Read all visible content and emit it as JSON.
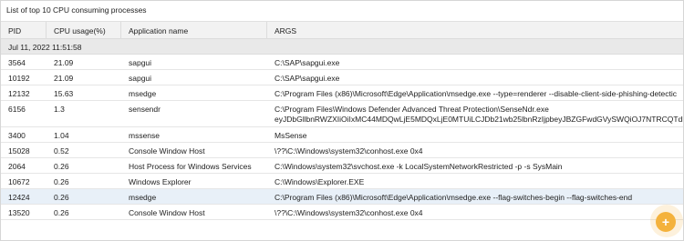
{
  "panel": {
    "title": "List of top 10 CPU consuming processes"
  },
  "table": {
    "columns": [
      "PID",
      "CPU usage(%)",
      "Application name",
      "ARGS"
    ],
    "group_label": "Jul 11, 2022 11:51:58",
    "rows": [
      {
        "pid": "3564",
        "cpu": "21.09",
        "app": "sapgui",
        "args": [
          "C:\\SAP\\sapgui.exe"
        ]
      },
      {
        "pid": "10192",
        "cpu": "21.09",
        "app": "sapgui",
        "args": [
          "C:\\SAP\\sapgui.exe"
        ]
      },
      {
        "pid": "12132",
        "cpu": "15.63",
        "app": "msedge",
        "args": [
          "C:\\Program Files (x86)\\Microsoft\\Edge\\Application\\msedge.exe --type=renderer --disable-client-side-phishing-detectic"
        ]
      },
      {
        "pid": "6156",
        "cpu": "1.3",
        "app": "sensendr",
        "args": [
          "C:\\Program Files\\Windows Defender Advanced Threat Protection\\SenseNdr.exe",
          "eyJDbGllbnRWZXIiOiIxMC44MDQwLjE5MDQxLjE0MTUiLCJDb21wb25lbnRzIjpbeyJBZGFwdGVySWQiOJ7NTRCQTdEC"
        ]
      },
      {
        "pid": "3400",
        "cpu": "1.04",
        "app": "mssense",
        "args": [
          "MsSense"
        ]
      },
      {
        "pid": "15028",
        "cpu": "0.52",
        "app": "Console Window Host",
        "args": [
          "\\??\\C:\\Windows\\system32\\conhost.exe 0x4"
        ]
      },
      {
        "pid": "2064",
        "cpu": "0.26",
        "app": "Host Process for Windows Services",
        "args": [
          "C:\\Windows\\system32\\svchost.exe -k LocalSystemNetworkRestricted -p -s SysMain"
        ]
      },
      {
        "pid": "10672",
        "cpu": "0.26",
        "app": "Windows Explorer",
        "args": [
          "C:\\Windows\\Explorer.EXE"
        ]
      },
      {
        "pid": "12424",
        "cpu": "0.26",
        "app": "msedge",
        "args": [
          "C:\\Program Files (x86)\\Microsoft\\Edge\\Application\\msedge.exe --flag-switches-begin --flag-switches-end"
        ]
      },
      {
        "pid": "13520",
        "cpu": "0.26",
        "app": "Console Window Host",
        "args": [
          "\\??\\C:\\Windows\\system32\\conhost.exe 0x4"
        ]
      }
    ]
  },
  "fab": {
    "icon": "plus-icon",
    "color": "#f4b23c",
    "glyph": "+"
  }
}
